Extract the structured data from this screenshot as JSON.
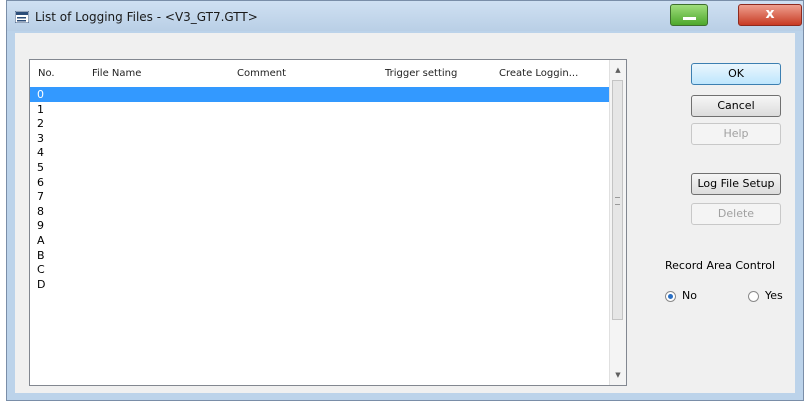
{
  "window": {
    "title": "List of Logging Files - <V3_GT7.GTT>",
    "close_glyph": "x"
  },
  "list": {
    "columns": [
      "No.",
      "File Name",
      "Comment",
      "Trigger setting",
      "Create Loggin..."
    ],
    "rows": [
      "0",
      "1",
      "2",
      "3",
      "4",
      "5",
      "6",
      "7",
      "8",
      "9",
      "A",
      "B",
      "C",
      "D"
    ],
    "selected_index": 0
  },
  "buttons": {
    "ok": "OK",
    "cancel": "Cancel",
    "help": "Help",
    "log_file_setup": "Log File Setup",
    "delete": "Delete"
  },
  "record_area_control": {
    "label": "Record Area Control",
    "options": [
      "No",
      "Yes"
    ],
    "selected": "No"
  },
  "icons": {
    "app": "list-icon",
    "minimize": "minimize-icon",
    "close": "close-icon",
    "scroll_up": "up-arrow-icon",
    "scroll_down": "down-arrow-icon"
  },
  "colors": {
    "selection": "#3399ff",
    "title_bar": "#bcd3ea"
  }
}
